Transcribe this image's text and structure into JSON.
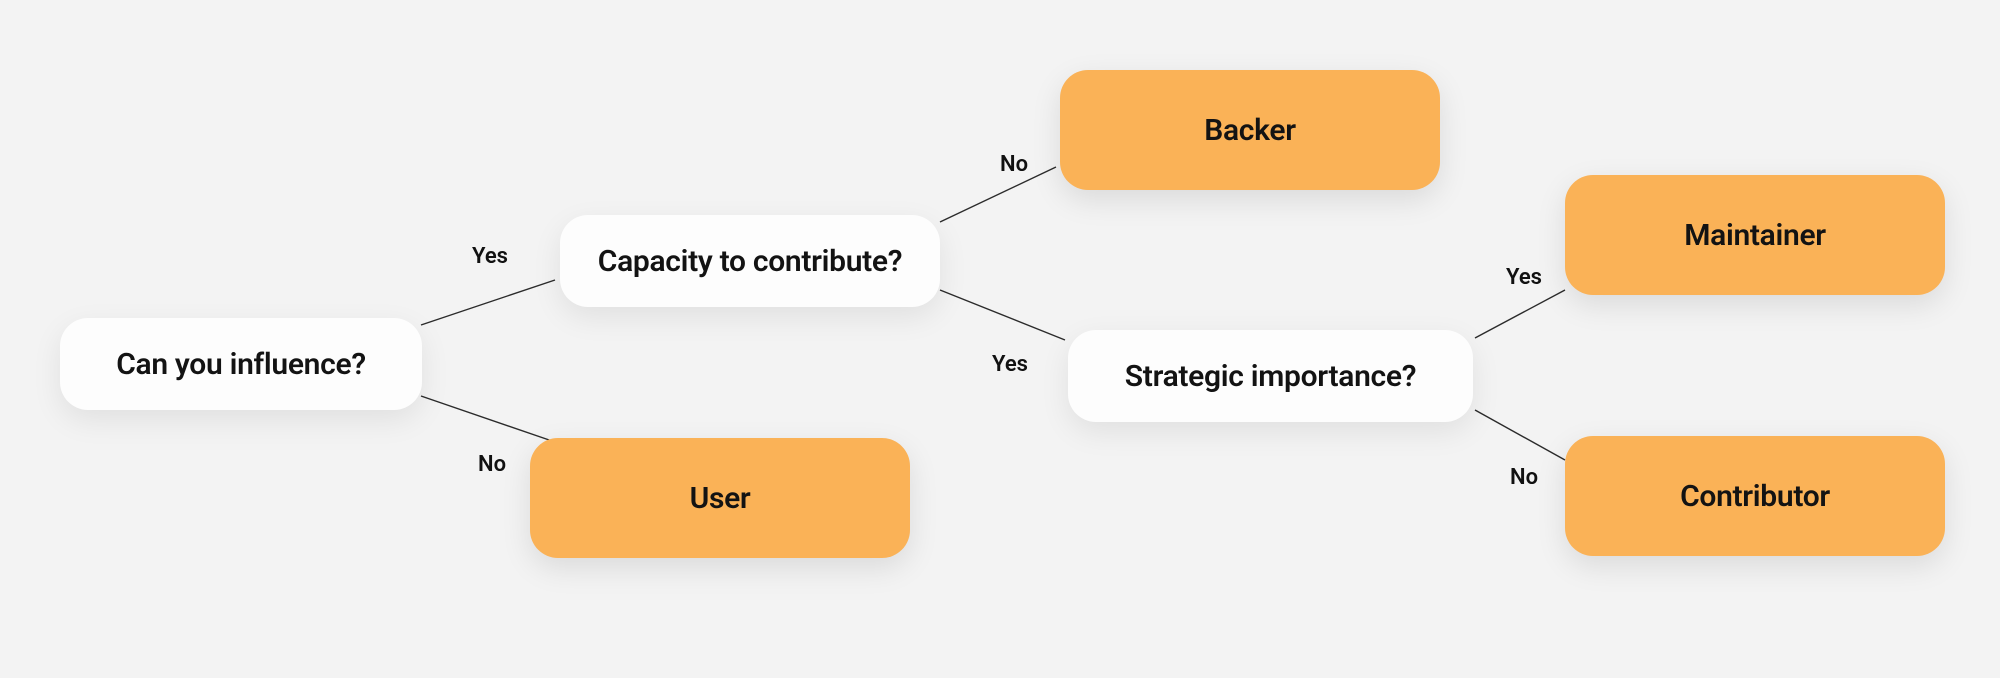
{
  "nodes": {
    "q_influence": {
      "label": "Can you influence?"
    },
    "q_capacity": {
      "label": "Capacity to contribute?"
    },
    "q_strategic": {
      "label": "Strategic importance?"
    },
    "o_user": {
      "label": "User"
    },
    "o_backer": {
      "label": "Backer"
    },
    "o_maintainer": {
      "label": "Maintainer"
    },
    "o_contributor": {
      "label": "Contributor"
    }
  },
  "edges": {
    "influence_yes": "Yes",
    "influence_no": "No",
    "capacity_no": "No",
    "capacity_yes": "Yes",
    "strategic_yes": "Yes",
    "strategic_no": "No"
  },
  "tree": {
    "root": "q_influence",
    "branches": [
      {
        "from": "q_influence",
        "answer": "Yes",
        "to": "q_capacity"
      },
      {
        "from": "q_influence",
        "answer": "No",
        "to": "o_user"
      },
      {
        "from": "q_capacity",
        "answer": "No",
        "to": "o_backer"
      },
      {
        "from": "q_capacity",
        "answer": "Yes",
        "to": "q_strategic"
      },
      {
        "from": "q_strategic",
        "answer": "Yes",
        "to": "o_maintainer"
      },
      {
        "from": "q_strategic",
        "answer": "No",
        "to": "o_contributor"
      }
    ]
  },
  "colors": {
    "question_bg": "#fdfdfd",
    "outcome_bg": "#fab257",
    "page_bg": "#f3f3f3",
    "text": "#131313"
  }
}
